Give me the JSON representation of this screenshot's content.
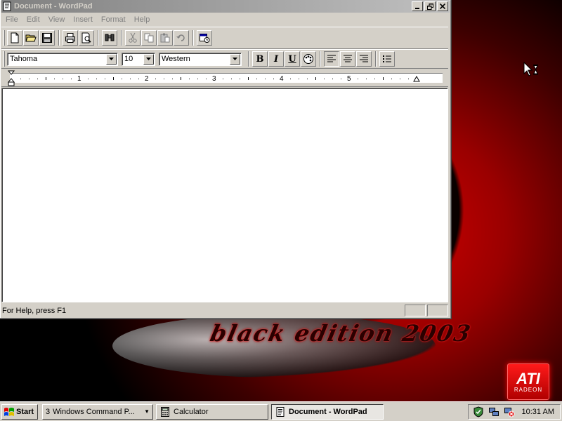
{
  "window": {
    "title": "Document - WordPad",
    "menu": [
      "File",
      "Edit",
      "View",
      "Insert",
      "Format",
      "Help"
    ]
  },
  "toolbar": {
    "buttons": [
      "new-document",
      "open",
      "save",
      "print",
      "print-preview",
      "find",
      "cut",
      "copy",
      "paste",
      "undo",
      "date-time"
    ]
  },
  "format_bar": {
    "font": "Tahoma",
    "size": "10",
    "script": "Western",
    "style_buttons": {
      "bold": "B",
      "italic": "I",
      "underline": "U"
    }
  },
  "ruler": {
    "numbers": [
      "1",
      "2",
      "3",
      "4",
      "5"
    ]
  },
  "status": {
    "help_text": "For Help, press F1"
  },
  "taskbar": {
    "start_label": "Start",
    "tasks": [
      {
        "count": "3",
        "label": "Windows Command P...",
        "grouped": true
      },
      {
        "label": "Calculator"
      },
      {
        "label": "Document - WordPad",
        "active": true
      }
    ],
    "clock": "10:31 AM"
  },
  "desktop": {
    "wallpaper_text": "black edition 2003",
    "logo_brand": "ATI",
    "logo_product": "RADEON"
  },
  "colors": {
    "desktop_red": "#d40000",
    "window_face": "#d4d0c8",
    "inactive_title": "#808080"
  }
}
